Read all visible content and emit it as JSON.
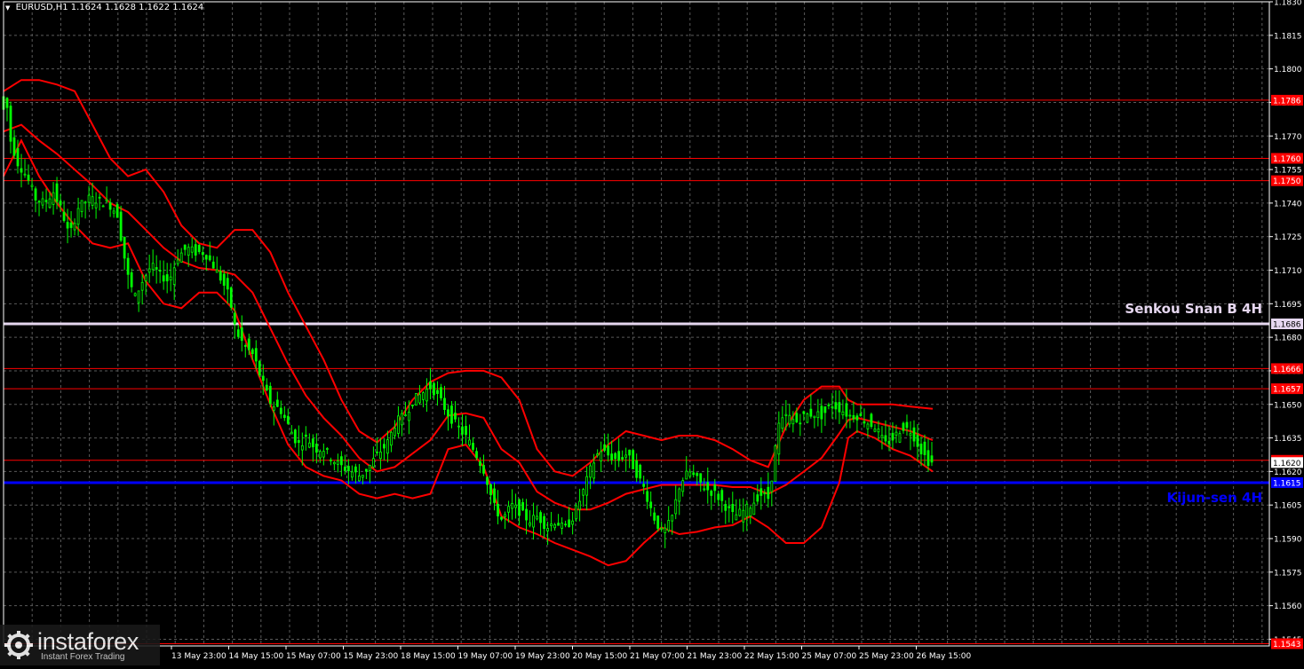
{
  "header": {
    "symbol": "EURUSD,H1",
    "ohlc": "1.1624 1.1628 1.1622 1.1624"
  },
  "logo": {
    "brand": "instaforex",
    "tagline": "Instant Forex Trading",
    "icon": "gear-icon"
  },
  "colors": {
    "background": "#000000",
    "grid": "#5a5a5a",
    "candles": "#00ff00",
    "bands": "#ff0000",
    "level_line": "#ff0000",
    "level_label_bg": "#ff0000",
    "senkou": "#e6d7f0",
    "kijun": "#0000ff",
    "axis_text": "#ffffff"
  },
  "chart_data": {
    "type": "candlestick",
    "ylim": [
      1.1542,
      1.183
    ],
    "y_ticks": [
      "1.1830",
      "1.1815",
      "1.1800",
      "1.1785",
      "1.1770",
      "1.1755",
      "1.1740",
      "1.1725",
      "1.1710",
      "1.1695",
      "1.1680",
      "1.1665",
      "1.1650",
      "1.1635",
      "1.1620",
      "1.1605",
      "1.1590",
      "1.1575",
      "1.1560",
      "1.1545"
    ],
    "x_labels": [
      "13 May 23:00",
      "14 May 15:00",
      "15 May 07:00",
      "15 May 23:00",
      "18 May 15:00",
      "19 May 07:00",
      "19 May 23:00",
      "20 May 15:00",
      "21 May 07:00",
      "21 May 23:00",
      "22 May 15:00",
      "25 May 07:00",
      "25 May 23:00",
      "26 May 15:00"
    ],
    "price_levels": [
      {
        "value": 1.1786,
        "label": "1.1786"
      },
      {
        "value": 1.176,
        "label": "1.1760"
      },
      {
        "value": 1.175,
        "label": "1.1750"
      },
      {
        "value": 1.1666,
        "label": "1.1666"
      },
      {
        "value": 1.1657,
        "label": "1.1657"
      },
      {
        "value": 1.1625,
        "label": "1.1625"
      },
      {
        "value": 1.1543,
        "label": "1.1543"
      }
    ],
    "senkou_span_b": {
      "value": 1.1686,
      "label": "1.1686",
      "name": "Senkou Snan B 4H"
    },
    "kijun_sen": {
      "value": 1.1615,
      "label": "1.1615",
      "name": "Kijun-sen 4H"
    },
    "current_price": {
      "value": 1.1624,
      "label": "1.1620"
    },
    "price_path": [
      [
        0,
        1.1782
      ],
      [
        6,
        1.179
      ],
      [
        12,
        1.1768
      ],
      [
        20,
        1.1758
      ],
      [
        30,
        1.1752
      ],
      [
        40,
        1.1742
      ],
      [
        50,
        1.174
      ],
      [
        60,
        1.1745
      ],
      [
        70,
        1.1736
      ],
      [
        78,
        1.1725
      ],
      [
        88,
        1.1738
      ],
      [
        100,
        1.1742
      ],
      [
        112,
        1.1741
      ],
      [
        122,
        1.174
      ],
      [
        132,
        1.1735
      ],
      [
        138,
        1.172
      ],
      [
        145,
        1.1705
      ],
      [
        152,
        1.1698
      ],
      [
        160,
        1.1705
      ],
      [
        170,
        1.1712
      ],
      [
        180,
        1.1708
      ],
      [
        190,
        1.1705
      ],
      [
        200,
        1.1716
      ],
      [
        210,
        1.172
      ],
      [
        220,
        1.1718
      ],
      [
        230,
        1.1718
      ],
      [
        240,
        1.1712
      ],
      [
        250,
        1.1705
      ],
      [
        258,
        1.1698
      ],
      [
        265,
        1.1683
      ],
      [
        275,
        1.1676
      ],
      [
        285,
        1.1672
      ],
      [
        295,
        1.166
      ],
      [
        305,
        1.165
      ],
      [
        315,
        1.1648
      ],
      [
        325,
        1.164
      ],
      [
        335,
        1.1632
      ],
      [
        345,
        1.1635
      ],
      [
        355,
        1.163
      ],
      [
        365,
        1.163
      ],
      [
        375,
        1.1625
      ],
      [
        385,
        1.1622
      ],
      [
        395,
        1.162
      ],
      [
        405,
        1.1618
      ],
      [
        415,
        1.1622
      ],
      [
        425,
        1.1628
      ],
      [
        435,
        1.1632
      ],
      [
        445,
        1.1642
      ],
      [
        455,
        1.1645
      ],
      [
        465,
        1.1652
      ],
      [
        475,
        1.1655
      ],
      [
        485,
        1.1658
      ],
      [
        495,
        1.1652
      ],
      [
        505,
        1.1645
      ],
      [
        515,
        1.164
      ],
      [
        525,
        1.1635
      ],
      [
        535,
        1.1628
      ],
      [
        545,
        1.162
      ],
      [
        555,
        1.1605
      ],
      [
        565,
        1.1598
      ],
      [
        575,
        1.1605
      ],
      [
        585,
        1.1602
      ],
      [
        595,
        1.1598
      ],
      [
        605,
        1.16
      ],
      [
        615,
        1.1595
      ],
      [
        625,
        1.1598
      ],
      [
        635,
        1.1594
      ],
      [
        645,
        1.16
      ],
      [
        655,
        1.161
      ],
      [
        665,
        1.1622
      ],
      [
        675,
        1.163
      ],
      [
        685,
        1.1627
      ],
      [
        695,
        1.1625
      ],
      [
        705,
        1.1628
      ],
      [
        715,
        1.162
      ],
      [
        725,
        1.1612
      ],
      [
        735,
        1.16
      ],
      [
        745,
        1.1592
      ],
      [
        755,
        1.1598
      ],
      [
        765,
        1.1615
      ],
      [
        775,
        1.162
      ],
      [
        785,
        1.1616
      ],
      [
        795,
        1.1612
      ],
      [
        805,
        1.161
      ],
      [
        815,
        1.1605
      ],
      [
        825,
        1.16
      ],
      [
        835,
        1.1602
      ],
      [
        845,
        1.1605
      ],
      [
        855,
        1.161
      ],
      [
        865,
        1.1608
      ],
      [
        875,
        1.164
      ],
      [
        885,
        1.1645
      ],
      [
        895,
        1.1642
      ],
      [
        905,
        1.1645
      ],
      [
        915,
        1.1646
      ],
      [
        925,
        1.1645
      ],
      [
        935,
        1.165
      ],
      [
        945,
        1.1648
      ],
      [
        955,
        1.1645
      ],
      [
        965,
        1.1645
      ],
      [
        975,
        1.1642
      ],
      [
        985,
        1.164
      ],
      [
        995,
        1.1632
      ],
      [
        1005,
        1.1635
      ],
      [
        1015,
        1.164
      ],
      [
        1025,
        1.1638
      ],
      [
        1035,
        1.163
      ],
      [
        1045,
        1.1624
      ]
    ],
    "upper_band": [
      [
        0,
        1.179
      ],
      [
        20,
        1.1795
      ],
      [
        40,
        1.1795
      ],
      [
        60,
        1.1793
      ],
      [
        80,
        1.179
      ],
      [
        100,
        1.1775
      ],
      [
        120,
        1.176
      ],
      [
        140,
        1.1752
      ],
      [
        160,
        1.1755
      ],
      [
        180,
        1.1745
      ],
      [
        200,
        1.173
      ],
      [
        220,
        1.1722
      ],
      [
        240,
        1.172
      ],
      [
        260,
        1.1728
      ],
      [
        280,
        1.1728
      ],
      [
        300,
        1.1718
      ],
      [
        320,
        1.17
      ],
      [
        340,
        1.1685
      ],
      [
        360,
        1.167
      ],
      [
        380,
        1.1652
      ],
      [
        400,
        1.1638
      ],
      [
        420,
        1.1633
      ],
      [
        440,
        1.164
      ],
      [
        460,
        1.1652
      ],
      [
        480,
        1.166
      ],
      [
        500,
        1.1664
      ],
      [
        520,
        1.1665
      ],
      [
        540,
        1.1665
      ],
      [
        560,
        1.1662
      ],
      [
        580,
        1.1652
      ],
      [
        600,
        1.163
      ],
      [
        620,
        1.162
      ],
      [
        640,
        1.1618
      ],
      [
        660,
        1.1624
      ],
      [
        680,
        1.1632
      ],
      [
        700,
        1.1638
      ],
      [
        720,
        1.1636
      ],
      [
        740,
        1.1634
      ],
      [
        760,
        1.1636
      ],
      [
        780,
        1.1636
      ],
      [
        800,
        1.1634
      ],
      [
        820,
        1.163
      ],
      [
        840,
        1.1625
      ],
      [
        860,
        1.1622
      ],
      [
        880,
        1.164
      ],
      [
        900,
        1.1652
      ],
      [
        920,
        1.1658
      ],
      [
        940,
        1.1658
      ],
      [
        950,
        1.1652
      ],
      [
        960,
        1.165
      ],
      [
        980,
        1.165
      ],
      [
        1000,
        1.165
      ],
      [
        1020,
        1.1649
      ],
      [
        1045,
        1.1648
      ]
    ],
    "lower_band": [
      [
        0,
        1.1752
      ],
      [
        20,
        1.1768
      ],
      [
        40,
        1.1752
      ],
      [
        60,
        1.174
      ],
      [
        80,
        1.173
      ],
      [
        100,
        1.1722
      ],
      [
        120,
        1.172
      ],
      [
        140,
        1.1722
      ],
      [
        160,
        1.1705
      ],
      [
        180,
        1.1695
      ],
      [
        200,
        1.1693
      ],
      [
        220,
        1.17
      ],
      [
        240,
        1.17
      ],
      [
        260,
        1.1692
      ],
      [
        280,
        1.167
      ],
      [
        300,
        1.165
      ],
      [
        320,
        1.1632
      ],
      [
        340,
        1.1622
      ],
      [
        360,
        1.1618
      ],
      [
        380,
        1.1616
      ],
      [
        400,
        1.161
      ],
      [
        420,
        1.1608
      ],
      [
        440,
        1.161
      ],
      [
        460,
        1.1608
      ],
      [
        480,
        1.161
      ],
      [
        500,
        1.163
      ],
      [
        520,
        1.1632
      ],
      [
        540,
        1.1622
      ],
      [
        560,
        1.16
      ],
      [
        580,
        1.1595
      ],
      [
        600,
        1.1592
      ],
      [
        620,
        1.1588
      ],
      [
        640,
        1.1585
      ],
      [
        660,
        1.1582
      ],
      [
        680,
        1.1578
      ],
      [
        700,
        1.158
      ],
      [
        720,
        1.1588
      ],
      [
        740,
        1.1595
      ],
      [
        760,
        1.1592
      ],
      [
        780,
        1.1593
      ],
      [
        800,
        1.1595
      ],
      [
        820,
        1.1596
      ],
      [
        840,
        1.16
      ],
      [
        860,
        1.1595
      ],
      [
        880,
        1.1588
      ],
      [
        900,
        1.1588
      ],
      [
        920,
        1.1595
      ],
      [
        940,
        1.1615
      ],
      [
        950,
        1.1635
      ],
      [
        960,
        1.1638
      ],
      [
        980,
        1.1635
      ],
      [
        1000,
        1.163
      ],
      [
        1020,
        1.1627
      ],
      [
        1045,
        1.162
      ]
    ],
    "middle_band": [
      [
        0,
        1.1772
      ],
      [
        20,
        1.1775
      ],
      [
        40,
        1.1768
      ],
      [
        60,
        1.1762
      ],
      [
        80,
        1.1755
      ],
      [
        100,
        1.1748
      ],
      [
        120,
        1.174
      ],
      [
        140,
        1.1736
      ],
      [
        160,
        1.1728
      ],
      [
        180,
        1.172
      ],
      [
        200,
        1.1714
      ],
      [
        220,
        1.1711
      ],
      [
        240,
        1.171
      ],
      [
        260,
        1.1708
      ],
      [
        280,
        1.17
      ],
      [
        300,
        1.1684
      ],
      [
        320,
        1.1668
      ],
      [
        340,
        1.1654
      ],
      [
        360,
        1.1644
      ],
      [
        380,
        1.1636
      ],
      [
        400,
        1.1626
      ],
      [
        420,
        1.162
      ],
      [
        440,
        1.1622
      ],
      [
        460,
        1.1628
      ],
      [
        480,
        1.1634
      ],
      [
        500,
        1.1645
      ],
      [
        520,
        1.1646
      ],
      [
        540,
        1.1644
      ],
      [
        560,
        1.163
      ],
      [
        580,
        1.1624
      ],
      [
        600,
        1.1611
      ],
      [
        620,
        1.1606
      ],
      [
        640,
        1.1603
      ],
      [
        660,
        1.1603
      ],
      [
        680,
        1.1606
      ],
      [
        700,
        1.161
      ],
      [
        720,
        1.1612
      ],
      [
        740,
        1.1614
      ],
      [
        760,
        1.1614
      ],
      [
        780,
        1.1614
      ],
      [
        800,
        1.1614
      ],
      [
        820,
        1.1613
      ],
      [
        840,
        1.1613
      ],
      [
        860,
        1.161
      ],
      [
        880,
        1.1614
      ],
      [
        900,
        1.162
      ],
      [
        920,
        1.1626
      ],
      [
        940,
        1.1637
      ],
      [
        950,
        1.1643
      ],
      [
        960,
        1.1644
      ],
      [
        980,
        1.1642
      ],
      [
        1000,
        1.164
      ],
      [
        1020,
        1.1638
      ],
      [
        1045,
        1.1634
      ]
    ]
  }
}
